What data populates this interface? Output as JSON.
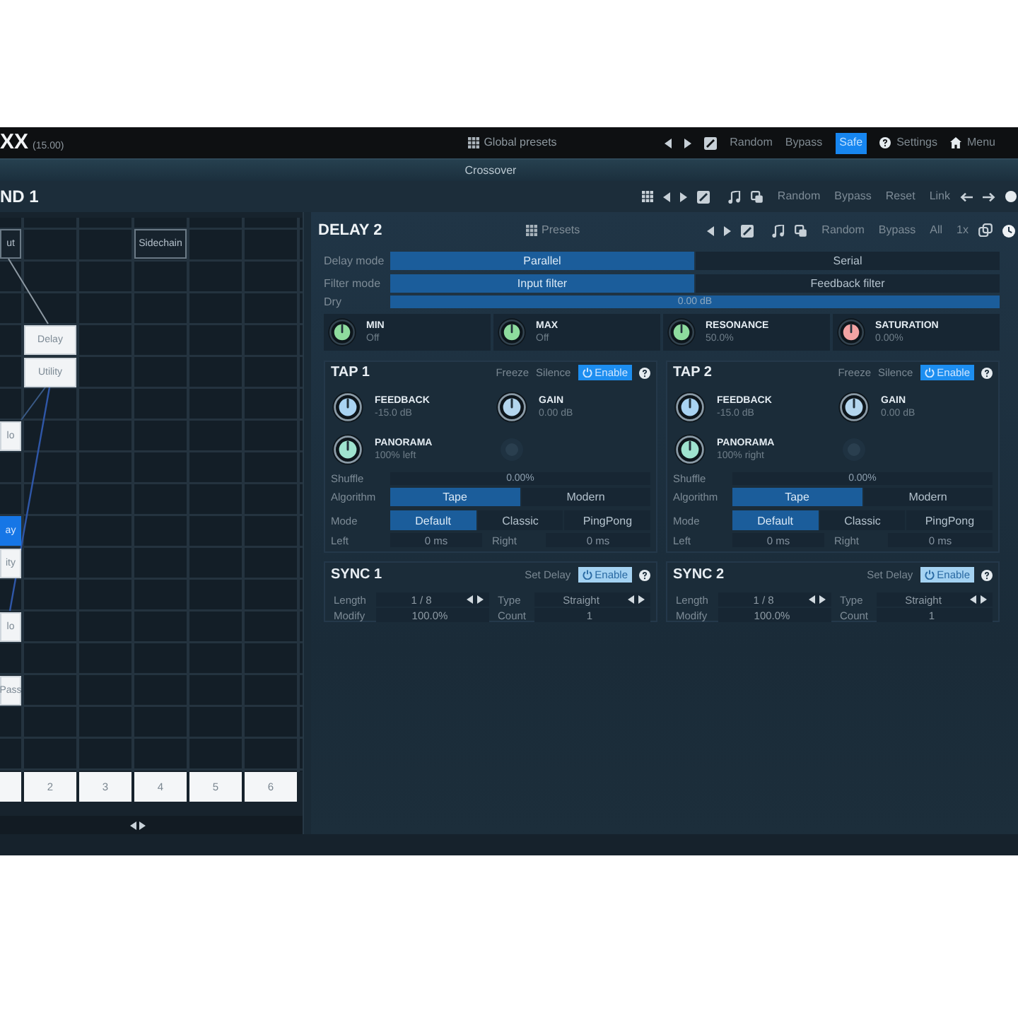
{
  "header": {
    "title": "XX",
    "version": "(15.00)",
    "presets": "Global presets",
    "buttons": [
      {
        "label": "Random",
        "kind": "text",
        "selected": false
      },
      {
        "label": "Bypass",
        "kind": "text",
        "selected": false
      },
      {
        "label": "Safe",
        "kind": "text",
        "selected": true
      },
      {
        "label": "Settings",
        "kind": "help",
        "selected": false
      },
      {
        "label": "Menu",
        "kind": "home",
        "selected": false
      }
    ]
  },
  "crossover": {
    "label": "Crossover"
  },
  "band": {
    "title": "ND 1",
    "buttons": [
      "Random",
      "Bypass",
      "Reset",
      "Link"
    ]
  },
  "routing": {
    "nodes": [
      {
        "label": "ut",
        "kind": "io",
        "selected": false
      },
      {
        "label": "Sidechain",
        "kind": "io",
        "selected": false
      },
      {
        "label": "Delay",
        "kind": "module",
        "selected": false
      },
      {
        "label": "Utility",
        "kind": "module",
        "selected": false
      },
      {
        "label": "lo",
        "kind": "module",
        "selected": false
      },
      {
        "label": "ay",
        "kind": "module",
        "selected": true
      },
      {
        "label": "ity",
        "kind": "module",
        "selected": false
      },
      {
        "label": "lo",
        "kind": "module",
        "selected": false
      },
      {
        "label": "Pass",
        "kind": "module",
        "selected": false
      }
    ],
    "slots": [
      "2",
      "3",
      "4",
      "5",
      "6"
    ]
  },
  "module": {
    "title": "DELAY 2",
    "presets": "Presets",
    "buttons": [
      "Random",
      "Bypass",
      "All",
      "1x"
    ],
    "modes": [
      {
        "label": "Delay mode",
        "options": [
          {
            "label": "Parallel",
            "selected": true
          },
          {
            "label": "Serial",
            "selected": false
          }
        ]
      },
      {
        "label": "Filter mode",
        "options": [
          {
            "label": "Input filter",
            "selected": true
          },
          {
            "label": "Feedback filter",
            "selected": false
          }
        ]
      }
    ],
    "dry": {
      "label": "Dry",
      "value": "0.00 dB",
      "level": 1
    },
    "knobs": [
      {
        "name": "MIN",
        "value": "Off",
        "color": "#8edc9e"
      },
      {
        "name": "MAX",
        "value": "Off",
        "color": "#8edc9e"
      },
      {
        "name": "RESONANCE",
        "value": "50.0%",
        "color": "#8edc9e"
      },
      {
        "name": "SATURATION",
        "value": "0.00%",
        "color": "#f2a3a3"
      }
    ]
  },
  "taps": [
    {
      "title": "TAP 1",
      "freeze": "Freeze",
      "silence": "Silence",
      "enable": {
        "label": "Enable",
        "on": true
      },
      "knobs": [
        {
          "name": "FEEDBACK",
          "value": "-15.0 dB",
          "color": "#a9d3f2"
        },
        {
          "name": "GAIN",
          "value": "0.00 dB",
          "color": "#b4d6ee"
        },
        {
          "name": "PANORAMA",
          "value": "100% left",
          "color": "#9fe3cf"
        }
      ],
      "shuffle": {
        "label": "Shuffle",
        "value": "0.00%"
      },
      "algorithm": {
        "label": "Algorithm",
        "options": [
          {
            "label": "Tape",
            "selected": true
          },
          {
            "label": "Modern",
            "selected": false
          }
        ]
      },
      "mode": {
        "label": "Mode",
        "options": [
          {
            "label": "Default",
            "selected": true
          },
          {
            "label": "Classic",
            "selected": false
          },
          {
            "label": "PingPong",
            "selected": false
          }
        ]
      },
      "left": {
        "label": "Left",
        "value": "0 ms"
      },
      "right": {
        "label": "Right",
        "value": "0 ms"
      }
    },
    {
      "title": "TAP 2",
      "freeze": "Freeze",
      "silence": "Silence",
      "enable": {
        "label": "Enable",
        "on": true
      },
      "knobs": [
        {
          "name": "FEEDBACK",
          "value": "-15.0 dB",
          "color": "#a9d3f2"
        },
        {
          "name": "GAIN",
          "value": "0.00 dB",
          "color": "#b4d6ee"
        },
        {
          "name": "PANORAMA",
          "value": "100% right",
          "color": "#9fe3cf"
        }
      ],
      "shuffle": {
        "label": "Shuffle",
        "value": "0.00%"
      },
      "algorithm": {
        "label": "Algorithm",
        "options": [
          {
            "label": "Tape",
            "selected": true
          },
          {
            "label": "Modern",
            "selected": false
          }
        ]
      },
      "mode": {
        "label": "Mode",
        "options": [
          {
            "label": "Default",
            "selected": true
          },
          {
            "label": "Classic",
            "selected": false
          },
          {
            "label": "PingPong",
            "selected": false
          }
        ]
      },
      "left": {
        "label": "Left",
        "value": "0 ms"
      },
      "right": {
        "label": "Right",
        "value": "0 ms"
      }
    }
  ],
  "syncs": [
    {
      "title": "SYNC 1",
      "set_delay": "Set Delay",
      "enable": {
        "label": "Enable",
        "on": false
      },
      "length": {
        "label": "Length",
        "value": "1 / 8"
      },
      "type": {
        "label": "Type",
        "value": "Straight"
      },
      "modify": {
        "label": "Modify",
        "value": "100.0%"
      },
      "count": {
        "label": "Count",
        "value": "1"
      }
    },
    {
      "title": "SYNC 2",
      "set_delay": "Set Delay",
      "enable": {
        "label": "Enable",
        "on": false
      },
      "length": {
        "label": "Length",
        "value": "1 / 8"
      },
      "type": {
        "label": "Type",
        "value": "Straight"
      },
      "modify": {
        "label": "Modify",
        "value": "100.0%"
      },
      "count": {
        "label": "Count",
        "value": "1"
      }
    }
  ]
}
